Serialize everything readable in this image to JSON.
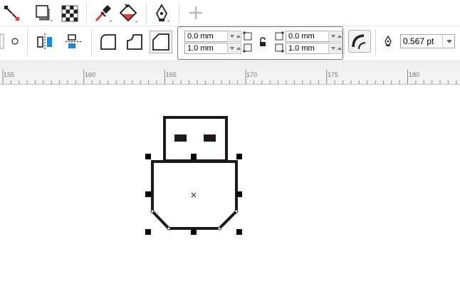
{
  "toolbar_top": {
    "icons": [
      "connector-tool-icon",
      "drop-shadow-icon",
      "transparency-icon",
      "eyedropper-icon",
      "interactive-fill-icon",
      "pen-outline-icon",
      "add-tool-icon"
    ]
  },
  "corner_fields": {
    "top_left": "0.0 mm",
    "bottom_left": "1.0 mm",
    "top_right": "0.0 mm",
    "bottom_right": "1.0 mm"
  },
  "outline_width": "0.567 pt",
  "ruler": {
    "labels": [
      "155",
      "160",
      "165",
      "170",
      "175",
      "180"
    ]
  },
  "colors": {
    "highlight": "#e04a5e",
    "accent_blue": "#1e88d6",
    "shape_stroke": "#1f1a17"
  }
}
